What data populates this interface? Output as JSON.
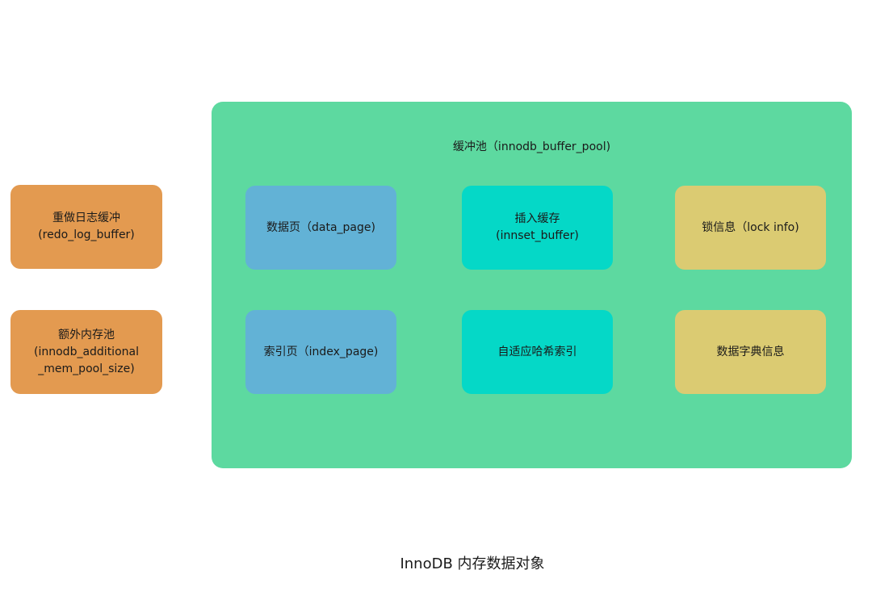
{
  "left_boxes": {
    "redo_log": {
      "line1": "重做日志缓冲",
      "line2": "(redo_log_buffer)"
    },
    "additional_pool": {
      "line1": "额外内存池",
      "line2": "(innodb_additional",
      "line3": "_mem_pool_size)"
    }
  },
  "buffer_pool": {
    "title": "缓冲池（innodb_buffer_pool)",
    "items": {
      "data_page": "数据页（data_page)",
      "insert_buffer": {
        "line1": "插入缓存",
        "line2": "(innset_buffer)"
      },
      "lock_info": "锁信息（lock info)",
      "index_page": "索引页（index_page)",
      "adaptive_hash": "自适应哈希索引",
      "dict_info": "数据字典信息"
    }
  },
  "caption": "InnoDB 内存数据对象",
  "colors": {
    "orange": "#E39A50",
    "green": "#5DD9A0",
    "blue": "#62B2D6",
    "cyan": "#05D8C7",
    "yellow": "#DBCB72"
  }
}
